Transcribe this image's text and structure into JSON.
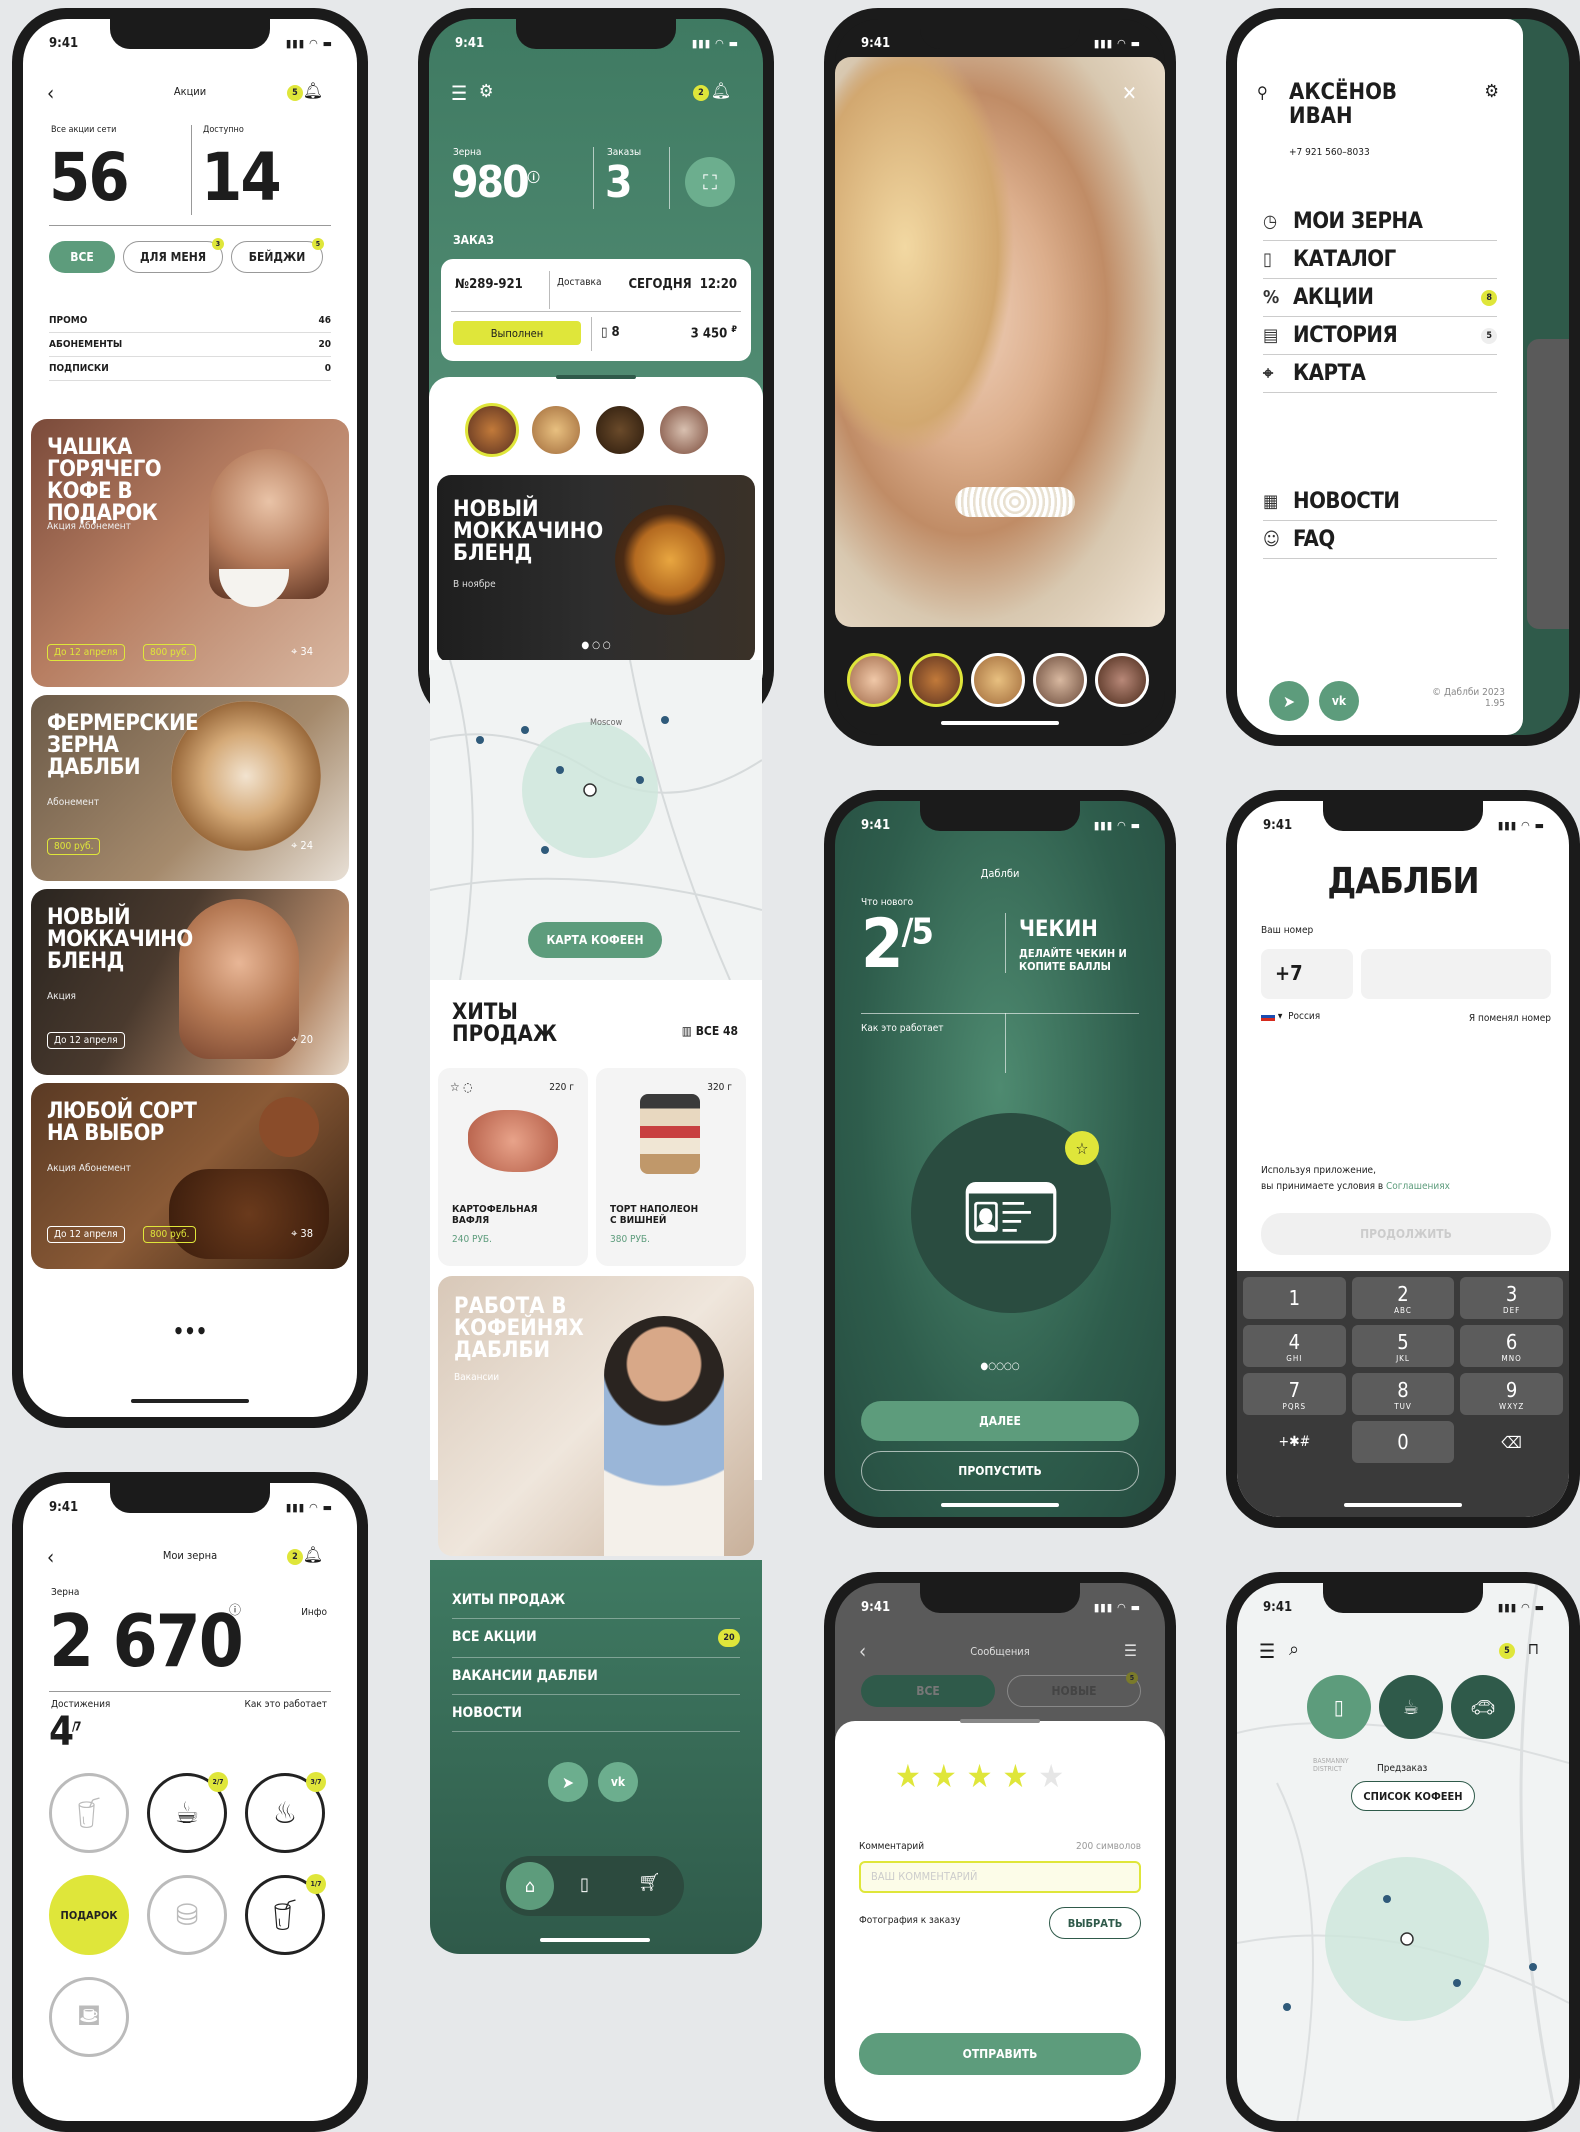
{
  "status_time": "9:41",
  "promos": {
    "title": "Акции",
    "bell_badge": "5",
    "all_label": "Все акции сети",
    "all_value": "56",
    "avail_label": "Доступно",
    "avail_value": "14",
    "filters": [
      {
        "label": "ВСЕ"
      },
      {
        "label": "ДЛЯ МЕНЯ",
        "badge": "3"
      },
      {
        "label": "БЕЙДЖИ",
        "badge": "5"
      }
    ],
    "rows": [
      {
        "label": "ПРОМО",
        "value": "46"
      },
      {
        "label": "АБОНЕМЕНТЫ",
        "value": "20"
      },
      {
        "label": "ПОДПИСКИ",
        "value": "0"
      }
    ],
    "cards": [
      {
        "title": "ЧАШКА ГОРЯЧЕГО КОФЕ В ПОДАРОК",
        "sub": "Акция   Абонемент",
        "tag1": "До 12 апреля",
        "tag2": "800 руб.",
        "count": "34"
      },
      {
        "title": "ФЕРМЕРСКИЕ ЗЕРНА ДАБЛБИ",
        "sub": "Абонемент",
        "tag1": "800 руб.",
        "count": "24"
      },
      {
        "title": "НОВЫЙ МОККАЧИНО БЛЕНД",
        "sub": "Акция",
        "tag1": "До 12 апреля",
        "count": "20"
      },
      {
        "title": "ЛЮБОЙ СОРТ НА ВЫБОР",
        "sub": "Акция   Абонемент",
        "tag1": "До 12 апреля",
        "tag2": "800 руб.",
        "count": "38"
      }
    ],
    "more": "•••"
  },
  "grains": {
    "title": "Мои зерна",
    "bell_badge": "2",
    "label": "Зерна",
    "info": "Инфо",
    "value": "2 670",
    "ach_label": "Достижения",
    "how": "Как это работает",
    "ach_value": "4",
    "ach_total": "/7",
    "badges": [
      "2/7",
      "3/7",
      "1/7"
    ],
    "gift": "ПОДАРОК"
  },
  "home": {
    "bell_badge": "2",
    "grains_label": "Зерна",
    "grains_value": "980",
    "orders_label": "Заказы",
    "orders_value": "3",
    "order_title": "ЗАКАЗ",
    "order_no": "№289-921",
    "order_type": "Доставка",
    "order_day": "СЕГОДНЯ",
    "order_time": "12:20",
    "order_status": "Выполнен",
    "order_items": "8",
    "order_sum": "3 450",
    "order_cur": "₽",
    "promo_title": "НОВЫЙ МОККАЧИНО БЛЕНД",
    "promo_sub": "В ноябре",
    "map_city": "Moscow",
    "map_button": "КАРТА КОФЕЕН",
    "hits_title": "ХИТЫ ПРОДАЖ",
    "hits_all": "ВСЕ 48",
    "products": [
      {
        "name": "КАРТОФЕЛЬНАЯ ВАФЛЯ",
        "price": "240 РУБ.",
        "weight": "220 г"
      },
      {
        "name": "ТОРТ НАПОЛЕОН С ВИШНЕЙ",
        "price": "380 РУБ.",
        "weight": "320 г"
      }
    ],
    "job_title": "РАБОТА В КОФЕЙНЯХ ДАБЛБИ",
    "job_sub": "Вакансии",
    "links": [
      {
        "label": "ХИТЫ ПРОДАЖ"
      },
      {
        "label": "ВСЕ АКЦИИ",
        "badge": "20"
      },
      {
        "label": "ВАКАНСИИ ДАБЛБИ"
      },
      {
        "label": "НОВОСТИ"
      }
    ]
  },
  "menu": {
    "name1": "АКСЁНОВ",
    "name2": "ИВАН",
    "phone": "+7 921 560–8033",
    "items": [
      {
        "label": "МОИ ЗЕРНА",
        "icon": "◷"
      },
      {
        "label": "КАТАЛОГ",
        "icon": "▯"
      },
      {
        "label": "АКЦИИ",
        "icon": "%",
        "badge": "8"
      },
      {
        "label": "ИСТОРИЯ",
        "icon": "▤",
        "badge": "5"
      },
      {
        "label": "КАРТА",
        "icon": "⌖"
      }
    ],
    "items2": [
      {
        "label": "НОВОСТИ",
        "icon": "▦"
      },
      {
        "label": "FAQ",
        "icon": "☺"
      }
    ],
    "copyright": "© Даблби 2023",
    "version": "1.95"
  },
  "onboard": {
    "brand": "Даблби",
    "whats_new": "Что нового",
    "step": "2",
    "total": "/5",
    "title": "ЧЕКИН",
    "desc": "ДЕЛАЙТЕ ЧЕКИН И КОПИТЕ БАЛЛЫ",
    "how": "Как это работает",
    "next": "ДАЛЕЕ",
    "skip": "ПРОПУСТИТЬ"
  },
  "login": {
    "brand": "ДАБЛБИ",
    "number_label": "Ваш номер",
    "code": "+7",
    "country": "Россия",
    "changed": "Я поменял номер",
    "terms1": "Используя приложение,",
    "terms2": "вы принимаете условия в ",
    "terms_link": "Соглашениях",
    "continue": "ПРОДОЛЖИТЬ",
    "keys": [
      {
        "n": "1",
        "l": ""
      },
      {
        "n": "2",
        "l": "ABC"
      },
      {
        "n": "3",
        "l": "DEF"
      },
      {
        "n": "4",
        "l": "GHI"
      },
      {
        "n": "5",
        "l": "JKL"
      },
      {
        "n": "6",
        "l": "MNO"
      },
      {
        "n": "7",
        "l": "PQRS"
      },
      {
        "n": "8",
        "l": "TUV"
      },
      {
        "n": "9",
        "l": "WXYZ"
      },
      {
        "n": "+✱#",
        "l": ""
      },
      {
        "n": "0",
        "l": ""
      },
      {
        "n": "⌫",
        "l": ""
      }
    ]
  },
  "review": {
    "title": "Сообщения",
    "tab_all": "ВСЕ",
    "tab_new": "НОВЫЕ",
    "tab_badge": "5",
    "comment_label": "Комментарий",
    "comment_count": "200 символов",
    "comment_placeholder": "ВАШ КОММЕНТАРИЙ",
    "photo_label": "Фотография к заказу",
    "choose": "ВЫБРАТЬ",
    "send": "ОТПРАВИТЬ",
    "rating": 4
  },
  "mapscreen": {
    "bell_badge": "5",
    "preorder": "Предзаказ",
    "list_button": "СПИСОК КОФЕЕН",
    "district": "BASMANNY DISTRICT"
  },
  "colors": {
    "accent": "#5d9c7c",
    "yellow": "#dfe63a",
    "dark_green": "#2f5a4a"
  }
}
